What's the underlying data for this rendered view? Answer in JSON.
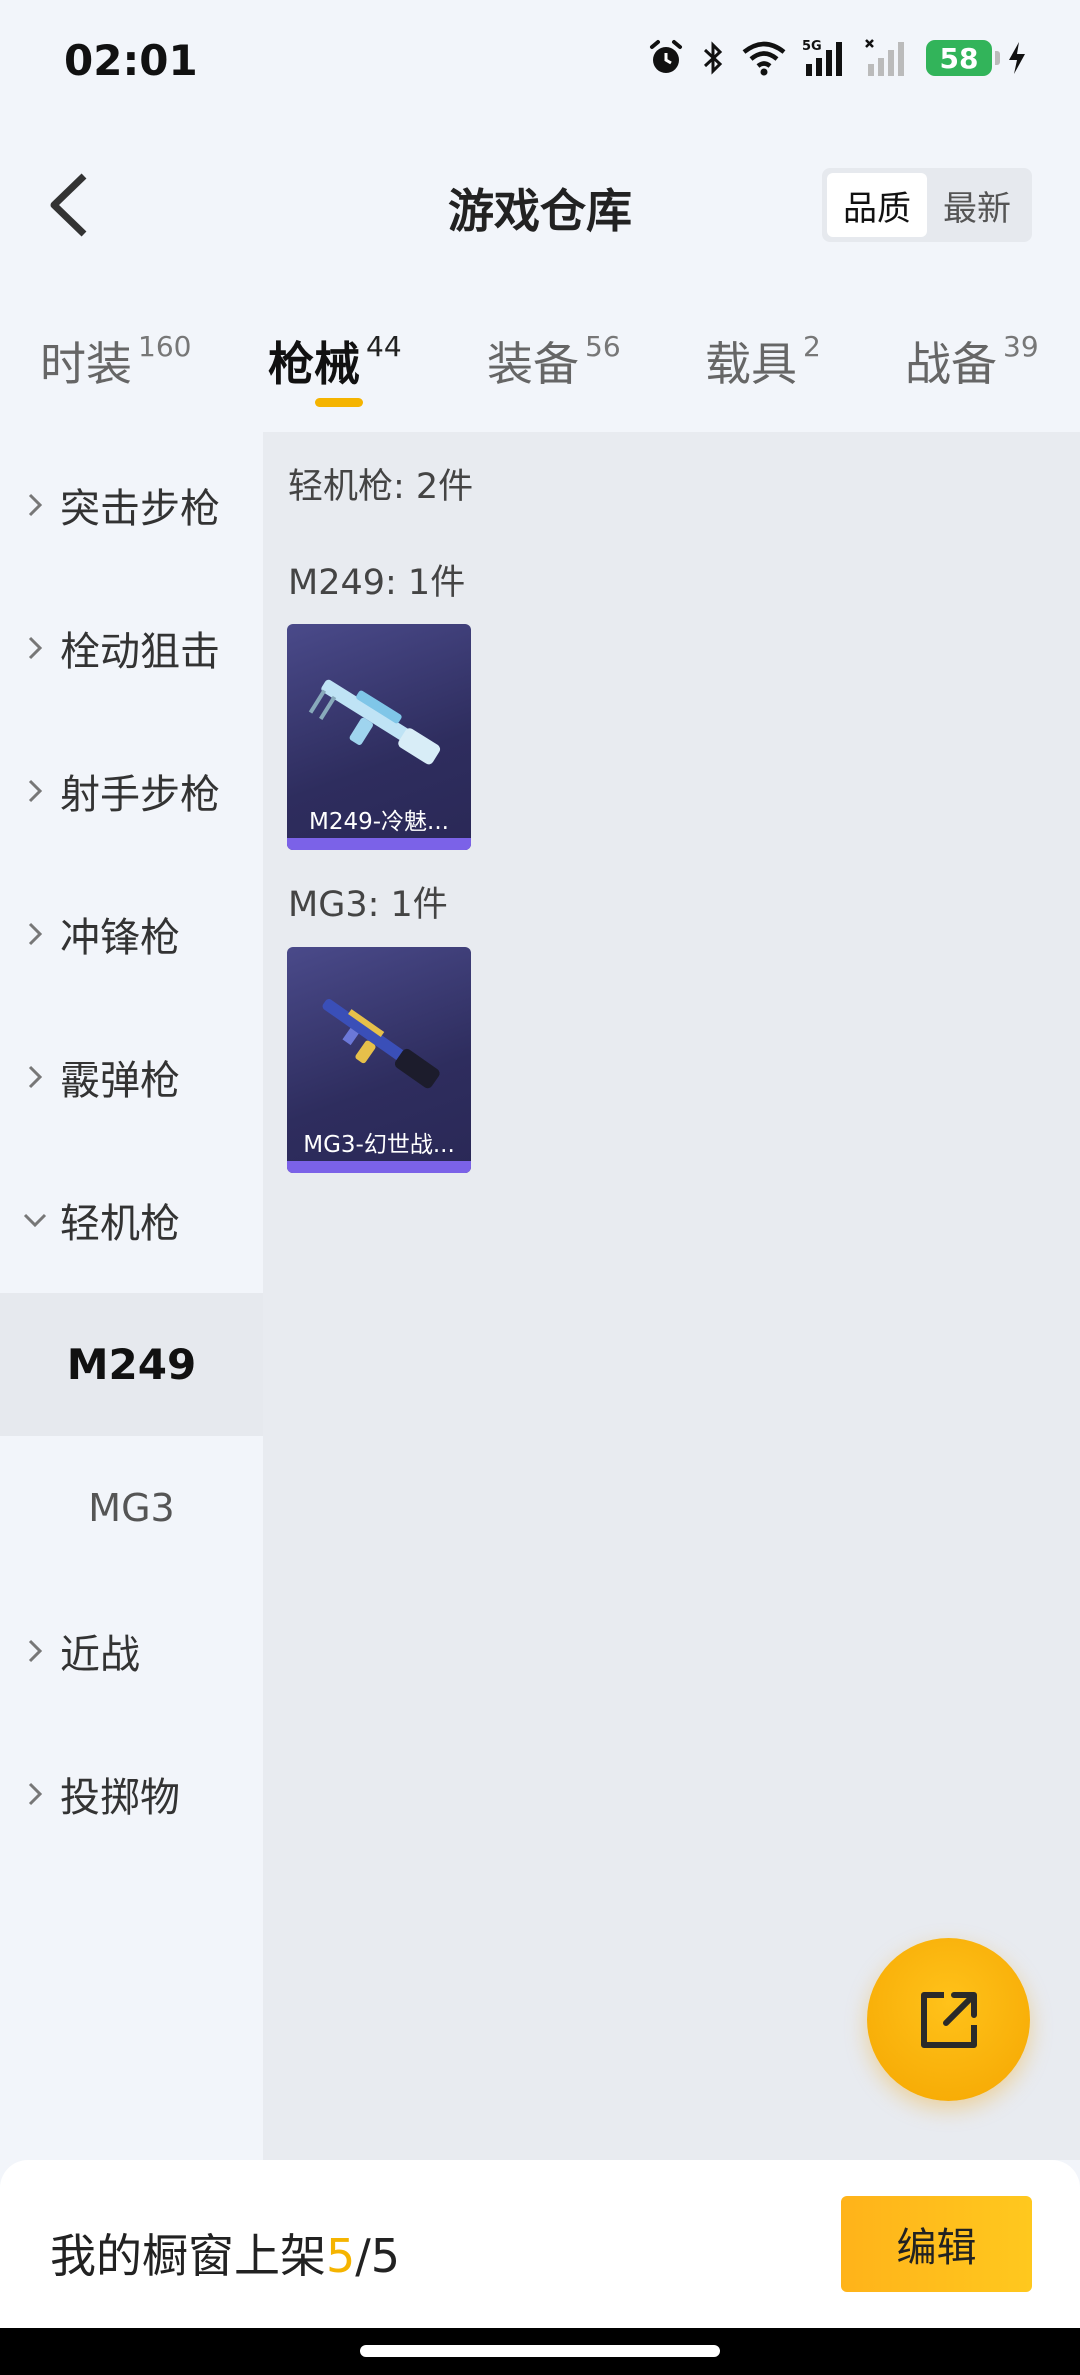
{
  "status": {
    "time": "02:01",
    "battery": "58",
    "network": "5G"
  },
  "header": {
    "title": "游戏仓库",
    "sort_options": [
      "品质",
      "最新"
    ],
    "active_sort": "品质"
  },
  "tabs": [
    {
      "label": "时装",
      "count": "160"
    },
    {
      "label": "枪械",
      "count": "44",
      "active": true
    },
    {
      "label": "装备",
      "count": "56"
    },
    {
      "label": "载具",
      "count": "2"
    },
    {
      "label": "战备",
      "count": "39"
    }
  ],
  "sidebar": {
    "items": [
      "突击步枪",
      "栓动狙击",
      "射手步枪",
      "冲锋枪",
      "霰弹枪",
      "轻机枪",
      "近战",
      "投掷物"
    ],
    "expanded": "轻机枪",
    "subitems": [
      "M249",
      "MG3"
    ],
    "active_sub": "M249"
  },
  "content": {
    "category_count": "轻机枪: 2件",
    "groups": [
      {
        "label": "M249: 1件",
        "item_name": "M249-冷魅..."
      },
      {
        "label": "MG3: 1件",
        "item_name": "MG3-幻世战..."
      }
    ]
  },
  "bottom": {
    "prefix": "我的橱窗上架 ",
    "current": "5",
    "sep_total": "/5",
    "edit_label": "编辑"
  },
  "colors": {
    "accent": "#f5b400",
    "card_bg": "#2e2d5e",
    "card_bar": "#7b62e8"
  }
}
